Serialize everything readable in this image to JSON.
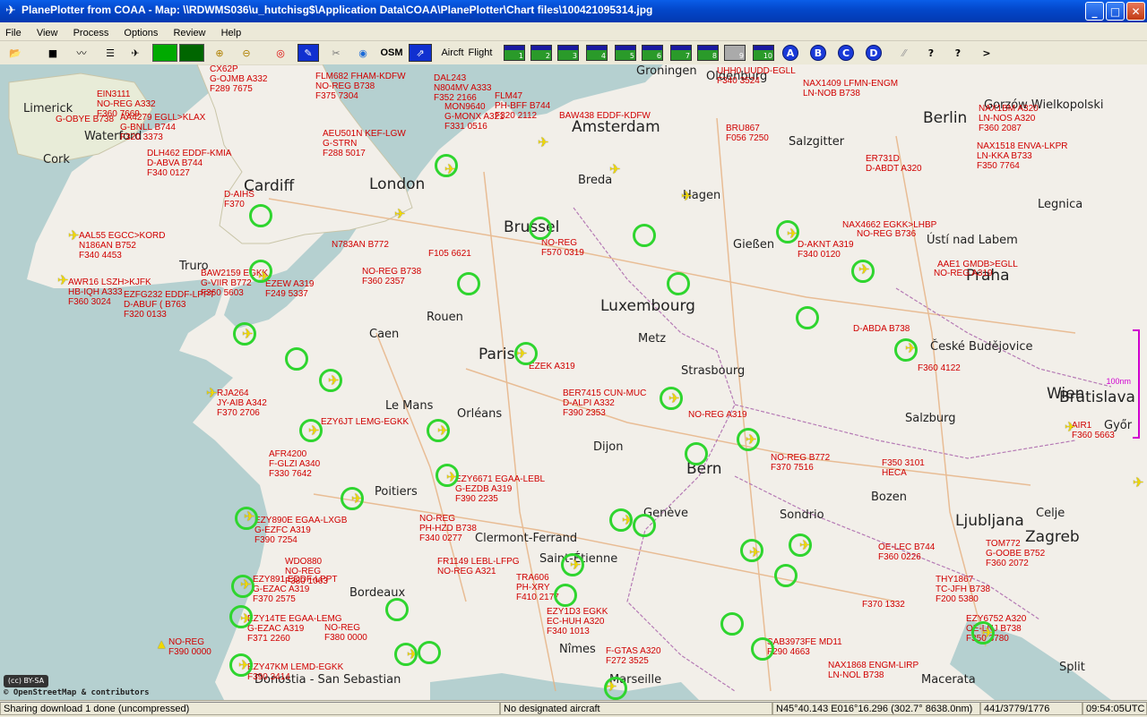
{
  "window": {
    "title": "PlanePlotter from COAA - Map: \\\\RDWMS036\\u_hutchisg$\\Application Data\\COAA\\PlanePlotter\\Chart files\\100421095314.jpg",
    "minimize": "_",
    "maximize": "□",
    "close": "✕"
  },
  "menu": [
    "File",
    "View",
    "Process",
    "Options",
    "Review",
    "Help"
  ],
  "toolbar": {
    "osm": "OSM",
    "aircraft": "Aircft",
    "flight": "Flight",
    "range_buttons": [
      "1",
      "2",
      "3",
      "4",
      "5",
      "6",
      "7",
      "8",
      "9",
      "10"
    ],
    "channels": [
      "A",
      "B",
      "C",
      "D"
    ],
    "help": "?",
    "context_help": "?",
    "more": ">"
  },
  "map": {
    "cities": [
      {
        "name": "Groningen",
        "size": 13
      },
      {
        "name": "Oldenburg",
        "size": 13
      },
      {
        "name": "Gorzów Wielkopolski",
        "size": 13
      },
      {
        "name": "Limerick",
        "size": 13
      },
      {
        "name": "Amsterdam",
        "size": 17
      },
      {
        "name": "Berlin",
        "size": 17
      },
      {
        "name": "Waterford",
        "size": 13
      },
      {
        "name": "Salzgitter",
        "size": 13
      },
      {
        "name": "Cork",
        "size": 13
      },
      {
        "name": "Cardiff",
        "size": 17
      },
      {
        "name": "London",
        "size": 17
      },
      {
        "name": "Breda",
        "size": 13
      },
      {
        "name": "Hagen",
        "size": 13
      },
      {
        "name": "Legnica",
        "size": 13
      },
      {
        "name": "Brussel",
        "size": 17
      },
      {
        "name": "Gießen",
        "size": 13
      },
      {
        "name": "Ústí nad Labem",
        "size": 13
      },
      {
        "name": "Truro",
        "size": 13
      },
      {
        "name": "Praha",
        "size": 17
      },
      {
        "name": "Rouen",
        "size": 13
      },
      {
        "name": "Luxembourg",
        "size": 17
      },
      {
        "name": "Caen",
        "size": 13
      },
      {
        "name": "Metz",
        "size": 13
      },
      {
        "name": "České Budějovice",
        "size": 13
      },
      {
        "name": "Paris",
        "size": 17
      },
      {
        "name": "Strasbourg",
        "size": 13
      },
      {
        "name": "Wien",
        "size": 17
      },
      {
        "name": "Bratislava",
        "size": 17
      },
      {
        "name": "Le Mans",
        "size": 13
      },
      {
        "name": "Orléans",
        "size": 13
      },
      {
        "name": "Salzburg",
        "size": 13
      },
      {
        "name": "Győr",
        "size": 13
      },
      {
        "name": "Dijon",
        "size": 13
      },
      {
        "name": "Bern",
        "size": 17
      },
      {
        "name": "Poitiers",
        "size": 13
      },
      {
        "name": "Bozen",
        "size": 13
      },
      {
        "name": "Genève",
        "size": 13
      },
      {
        "name": "Sondrio",
        "size": 13
      },
      {
        "name": "Ljubljana",
        "size": 17
      },
      {
        "name": "Celje",
        "size": 13
      },
      {
        "name": "Zagreb",
        "size": 17
      },
      {
        "name": "Clermont-Ferrand",
        "size": 13
      },
      {
        "name": "Saint-Étienne",
        "size": 13
      },
      {
        "name": "Bordeaux",
        "size": 13
      },
      {
        "name": "Nîmes",
        "size": 13
      },
      {
        "name": "Macerata",
        "size": 13
      },
      {
        "name": "Split",
        "size": 13
      },
      {
        "name": "Donostia - San Sebastian",
        "size": 13
      },
      {
        "name": "Marseille",
        "size": 13
      }
    ],
    "aircraft": [
      {
        "label": "CX62P\nG-OJMB A332\nF289 7675"
      },
      {
        "label": "FLM682 FHAM-KDFW\nNO-REG B738\nF375 7304"
      },
      {
        "label": "DAL243\nN804MV A333\nF352 2166"
      },
      {
        "label": "FLM47\nPH-BFF B744\nF320 2112"
      },
      {
        "label": "UHH0 UUDD-EGLL\nF340 3524"
      },
      {
        "label": "NAX1409 LFMN-ENGM\nLN-NOB B738"
      },
      {
        "label": "NAX1BM A320\nLN-NOS A320\nF360 2087"
      },
      {
        "label": "EIN3111\nNO-REG A332\nF360 7669"
      },
      {
        "label": "AA4279 EGLL>KLAX\nG-BNLL B744\nF320 3373"
      },
      {
        "label": "G-OBYE B738"
      },
      {
        "label": "AEU501N KEF-LGW\nG-STRN\nF288 5017"
      },
      {
        "label": "MON9640\nG-MONX A321\nF331 0516"
      },
      {
        "label": "BAW438 EDDF-KDFW"
      },
      {
        "label": "BRU867\nF056 7250"
      },
      {
        "label": "NAX1518 ENVA-LKPR\nLN-KKA B733\nF350 7764"
      },
      {
        "label": "DLH462 EDDF-KMIA\nD-ABVA B744\nF340 0127"
      },
      {
        "label": "ER731D\nD-ABDT A320"
      },
      {
        "label": "D-AIHS\nF370"
      },
      {
        "label": "AAL55 EGCC>KORD\nN186AN B752\nF340 4453"
      },
      {
        "label": "AWR16 LSZH>KJFK\nHB-IQH A333\nF360 3024"
      },
      {
        "label": "BAW2159 EGKK\nG-VIIR B772\nF360 5603"
      },
      {
        "label": "EZFG232 EDDF-LPPT\nD-ABUF ( B763\nF320 0133"
      },
      {
        "label": "EZEW A319\nF249 5337"
      },
      {
        "label": "N783AN B772"
      },
      {
        "label": "NO-REG B738\nF360 2357"
      },
      {
        "label": "F105 6621"
      },
      {
        "label": "NO-REG\nF570 0319"
      },
      {
        "label": "D-AKNT A319\nF340 0120"
      },
      {
        "label": "NAX4662 EGKK>LHBP"
      },
      {
        "label": "NO-REG B736"
      },
      {
        "label": "AAE1 GMDB>EGLL"
      },
      {
        "label": "NO-REG A319"
      },
      {
        "label": "RJA264\nJY-AIB A342\nF370 2706"
      },
      {
        "label": "BER7415 CUN-MUC\nD-ALPI A332\nF390 2353"
      },
      {
        "label": "EZEK A319"
      },
      {
        "label": "EZY6JT LEMG-EGKK"
      },
      {
        "label": "AFR4200\nF-GLZI A340\nF330 7642"
      },
      {
        "label": "EZY6671 EGAA-LEBL\nG-EZDB A319\nF390 2235"
      },
      {
        "label": "EZY890E EGAA-LXGB\nG-EZFC A319\nF390 7254"
      },
      {
        "label": "NO-REG\nPH-HZD B738\nF340 0277"
      },
      {
        "label": "WDO880\nNO-REG\nF380 1063"
      },
      {
        "label": "EZY891 EDDF-LPPT\nG-EZAC A319\nF370 2575"
      },
      {
        "label": "EZY14TE EGAA-LEMG\nG-EZAC A319\nF371 2260"
      },
      {
        "label": "NO-REG\nF380 0000"
      },
      {
        "label": "EZY47KM LEMD-EGKK\nF390 3414"
      },
      {
        "label": "NO-REG\nF390 0000"
      },
      {
        "label": "FR1149 LEBL-LFPG\nNO-REG A321"
      },
      {
        "label": "TRA606\nPH-XRY\nF410 2177"
      },
      {
        "label": "EZY1D3 EGKK\nEC-HUH A320\nF340 1013"
      },
      {
        "label": "F-GTAS A320\nF272 3525"
      },
      {
        "label": "TOM772\nG-OOBE B752\nF360 2072"
      },
      {
        "label": "THY1867\nTC-JFH B738\nF200 5380"
      },
      {
        "label": "EZY6752 A320\nOE-LNJ B738\nF350 3780"
      },
      {
        "label": "NAX1868 ENGM-LIRP\nLN-NOL B738"
      },
      {
        "label": "SAB3973FE MD11\nF290 4663"
      },
      {
        "label": "AIR1\nF360 5663"
      },
      {
        "label": "OE-LEC B744\nF360 0226"
      },
      {
        "label": "F370 1332"
      },
      {
        "label": "F350 3101\nHECA"
      },
      {
        "label": "F360 4122"
      },
      {
        "label": "NO-REG B772\nF370 7516"
      },
      {
        "label": "NO-REG A319"
      },
      {
        "label": "D-ABDA B738"
      }
    ],
    "scale_label": "100nm",
    "cc_badge": "(cc) BY-SA",
    "credit": "© OpenStreetMap & contributors"
  },
  "status": {
    "download": "Sharing download 1 done (uncompressed)",
    "designated": "No designated aircraft",
    "position": "N45°40.143 E016°16.296 (302.7° 8638.0nm)",
    "counts": "441/3779/1776",
    "time": "09:54:05UTC"
  }
}
